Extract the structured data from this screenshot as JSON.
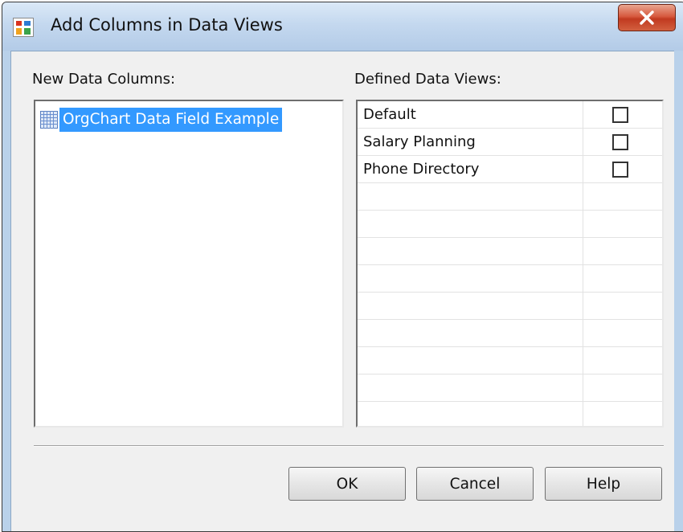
{
  "window": {
    "title": "Add Columns in Data Views",
    "close_glyph": "X",
    "app_icon": "org-chart-app-icon"
  },
  "left_panel": {
    "label": "New Data Columns:",
    "items": [
      {
        "label": "OrgChart Data Field Example",
        "icon": "data-field-grid-icon",
        "selected": true
      }
    ]
  },
  "right_panel": {
    "label": "Defined Data Views:",
    "rows": [
      {
        "name": "Default",
        "checked": false
      },
      {
        "name": "Salary Planning",
        "checked": false
      },
      {
        "name": "Phone Directory",
        "checked": false
      }
    ],
    "empty_row_count": 9
  },
  "buttons": {
    "ok": "OK",
    "cancel": "Cancel",
    "help": "Help"
  },
  "colors": {
    "selection": "#3399ff",
    "title_bar": "#c4d8ef",
    "close_button": "#c94a2f"
  }
}
